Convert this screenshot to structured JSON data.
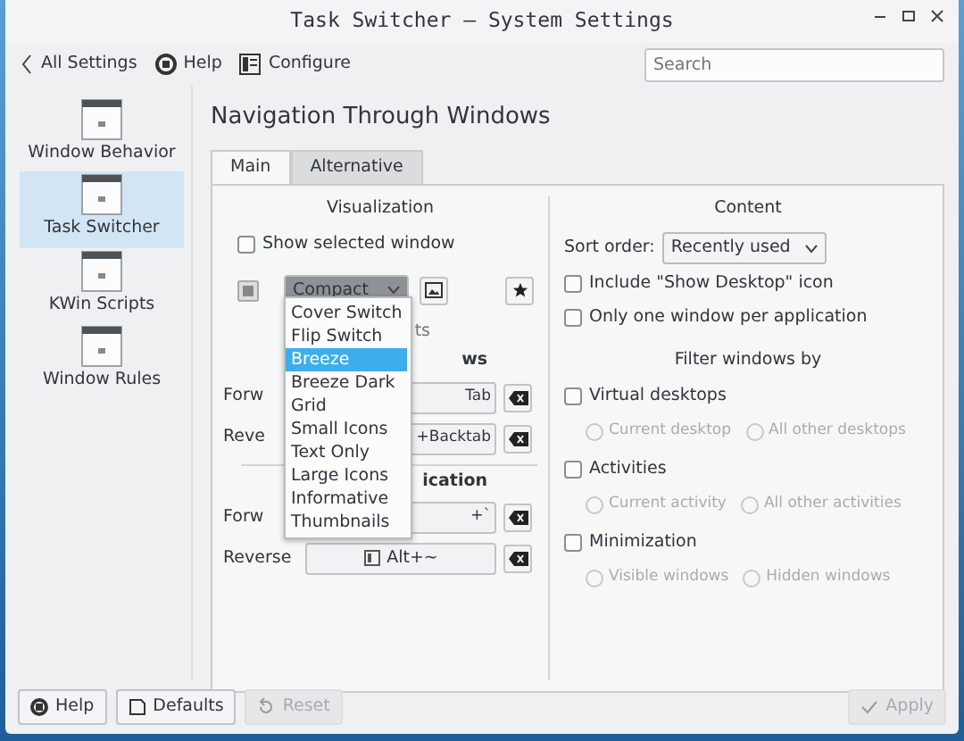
{
  "window": {
    "title": "Task Switcher — System Settings"
  },
  "toolbar": {
    "back": "All Settings",
    "help": "Help",
    "configure": "Configure",
    "search_placeholder": "Search"
  },
  "sidebar": {
    "items": [
      {
        "label": "Window Behavior",
        "selected": false
      },
      {
        "label": "Task Switcher",
        "selected": true
      },
      {
        "label": "KWin Scripts",
        "selected": false
      },
      {
        "label": "Window Rules",
        "selected": false
      }
    ]
  },
  "heading": "Navigation Through Windows",
  "tabs": [
    {
      "label": "Main",
      "selected": true
    },
    {
      "label": "Alternative",
      "selected": false
    }
  ],
  "visualization": {
    "title": "Visualization",
    "show_selected_window": {
      "label": "Show selected window",
      "checked": false
    },
    "effect": {
      "value": "Compact"
    },
    "dropdown": {
      "items": [
        {
          "label": "Cover Switch",
          "selected": false
        },
        {
          "label": "Flip Switch",
          "selected": false
        },
        {
          "label": "Breeze",
          "selected": true
        },
        {
          "label": "Breeze Dark",
          "selected": false
        },
        {
          "label": "Grid",
          "selected": false
        },
        {
          "label": "Small Icons",
          "selected": false
        },
        {
          "label": "Text Only",
          "selected": false
        },
        {
          "label": "Large Icons",
          "selected": false
        },
        {
          "label": "Informative",
          "selected": false
        },
        {
          "label": "Thumbnails",
          "selected": false
        }
      ]
    }
  },
  "shortcuts": [
    {
      "kind": "caption",
      "text": "ts"
    },
    {
      "kind": "heading",
      "text": "ws"
    },
    {
      "kind": "shortcut",
      "label": "Forw",
      "key": "Tab",
      "cut": true
    },
    {
      "kind": "shortcut",
      "label": "Reve",
      "key": "+Backtab",
      "cut": true
    },
    {
      "kind": "divider"
    },
    {
      "kind": "heading",
      "text": "ication"
    },
    {
      "kind": "shortcut",
      "label": "Forw",
      "key": "+`",
      "cut": true
    },
    {
      "kind": "shortcut",
      "label": "Reverse",
      "key": "Alt+~",
      "cut": false
    }
  ],
  "content": {
    "title": "Content",
    "sort_order": {
      "label": "Sort order:",
      "value": "Recently used"
    },
    "checks": [
      {
        "label": "Include \"Show Desktop\" icon",
        "checked": false
      },
      {
        "label": "Only one window per application",
        "checked": false
      }
    ],
    "filter_title": "Filter windows by",
    "filters": [
      {
        "label": "Virtual desktops",
        "checked": false,
        "options": [
          {
            "label": "Current desktop",
            "selected": false
          },
          {
            "label": "All other desktops",
            "selected": false
          }
        ]
      },
      {
        "label": "Activities",
        "checked": false,
        "options": [
          {
            "label": "Current activity",
            "selected": false
          },
          {
            "label": "All other activities",
            "selected": false
          }
        ]
      },
      {
        "label": "Minimization",
        "checked": false,
        "options": [
          {
            "label": "Visible windows",
            "selected": false
          },
          {
            "label": "Hidden windows",
            "selected": false
          }
        ]
      }
    ]
  },
  "footer": [
    {
      "kind": "help",
      "label": "Help",
      "disabled": false
    },
    {
      "kind": "defaults",
      "label": "Defaults",
      "disabled": false
    },
    {
      "kind": "reset",
      "label": "Reset",
      "disabled": true
    },
    {
      "kind": "apply",
      "label": "Apply",
      "disabled": true
    }
  ]
}
